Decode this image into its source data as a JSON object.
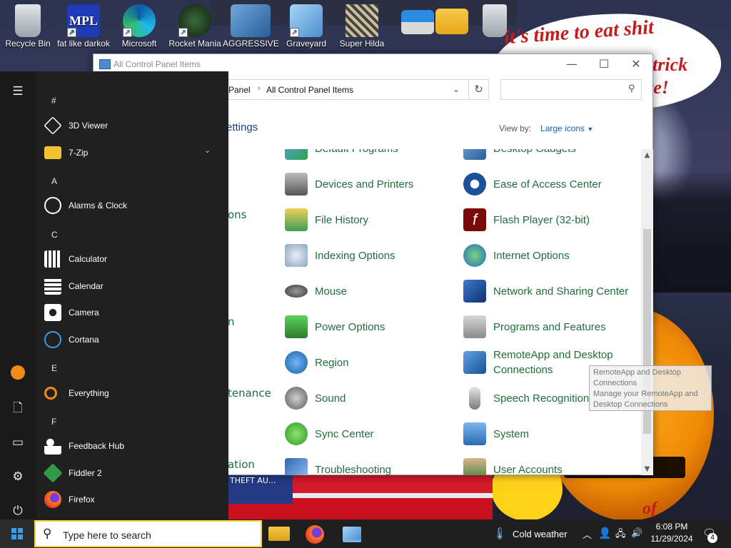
{
  "desktop": {
    "icons": [
      {
        "label": "Recycle Bin"
      },
      {
        "label": "fat like darkok"
      },
      {
        "label": "Microsoft"
      },
      {
        "label": "Rocket Mania"
      },
      {
        "label": "AGGRESSIVE"
      },
      {
        "label": "Graveyard"
      },
      {
        "label": "Super Hilda"
      }
    ],
    "meme": {
      "line1": "it's time to eat shit",
      "line2": "trick",
      "line3": "te!",
      "line4": "of"
    }
  },
  "window": {
    "title": "All Control Panel Items",
    "breadcrumb": [
      "Panel",
      "All Control Panel Items"
    ],
    "heading_partial": "ettings",
    "view_by_label": "View by:",
    "view_by_value": "Large icons",
    "left_column_partials": [
      "ons",
      "n",
      "tenance",
      "ation"
    ],
    "items_left": [
      "Default Programs",
      "Devices and Printers",
      "File History",
      "Indexing Options",
      "Mouse",
      "Power Options",
      "Region",
      "Sound",
      "Sync Center",
      "Troubleshooting"
    ],
    "items_right": [
      "Desktop Gadgets",
      "Ease of Access Center",
      "Flash Player (32-bit)",
      "Internet Options",
      "Network and Sharing Center",
      "Programs and Features",
      "RemoteApp and Desktop Connections",
      "Speech Recognition",
      "System",
      "User Accounts"
    ],
    "tooltip": {
      "title": "RemoteApp and Desktop Connections",
      "body": "Manage your RemoteApp and Desktop Connections"
    },
    "under_window_text": "THEFT AU..."
  },
  "start_menu": {
    "sections": [
      {
        "letter": "#",
        "apps": [
          "3D Viewer",
          "7-Zip"
        ]
      },
      {
        "letter": "A",
        "apps": [
          "Alarms & Clock"
        ]
      },
      {
        "letter": "C",
        "apps": [
          "Calculator",
          "Calendar",
          "Camera",
          "Cortana"
        ]
      },
      {
        "letter": "E",
        "apps": [
          "Everything"
        ]
      },
      {
        "letter": "F",
        "apps": [
          "Feedback Hub",
          "Fiddler 2",
          "Firefox"
        ]
      }
    ]
  },
  "taskbar": {
    "search_placeholder": "Type here to search",
    "weather": "Cold weather",
    "time": "6:08 PM",
    "date": "11/29/2024",
    "notifications_count": "4"
  },
  "colors": {
    "link_green": "#1e6e3c",
    "start_bg": "#202020",
    "taskbar_bg": "#1f1f1f",
    "accent_blue": "#3b9bed"
  }
}
